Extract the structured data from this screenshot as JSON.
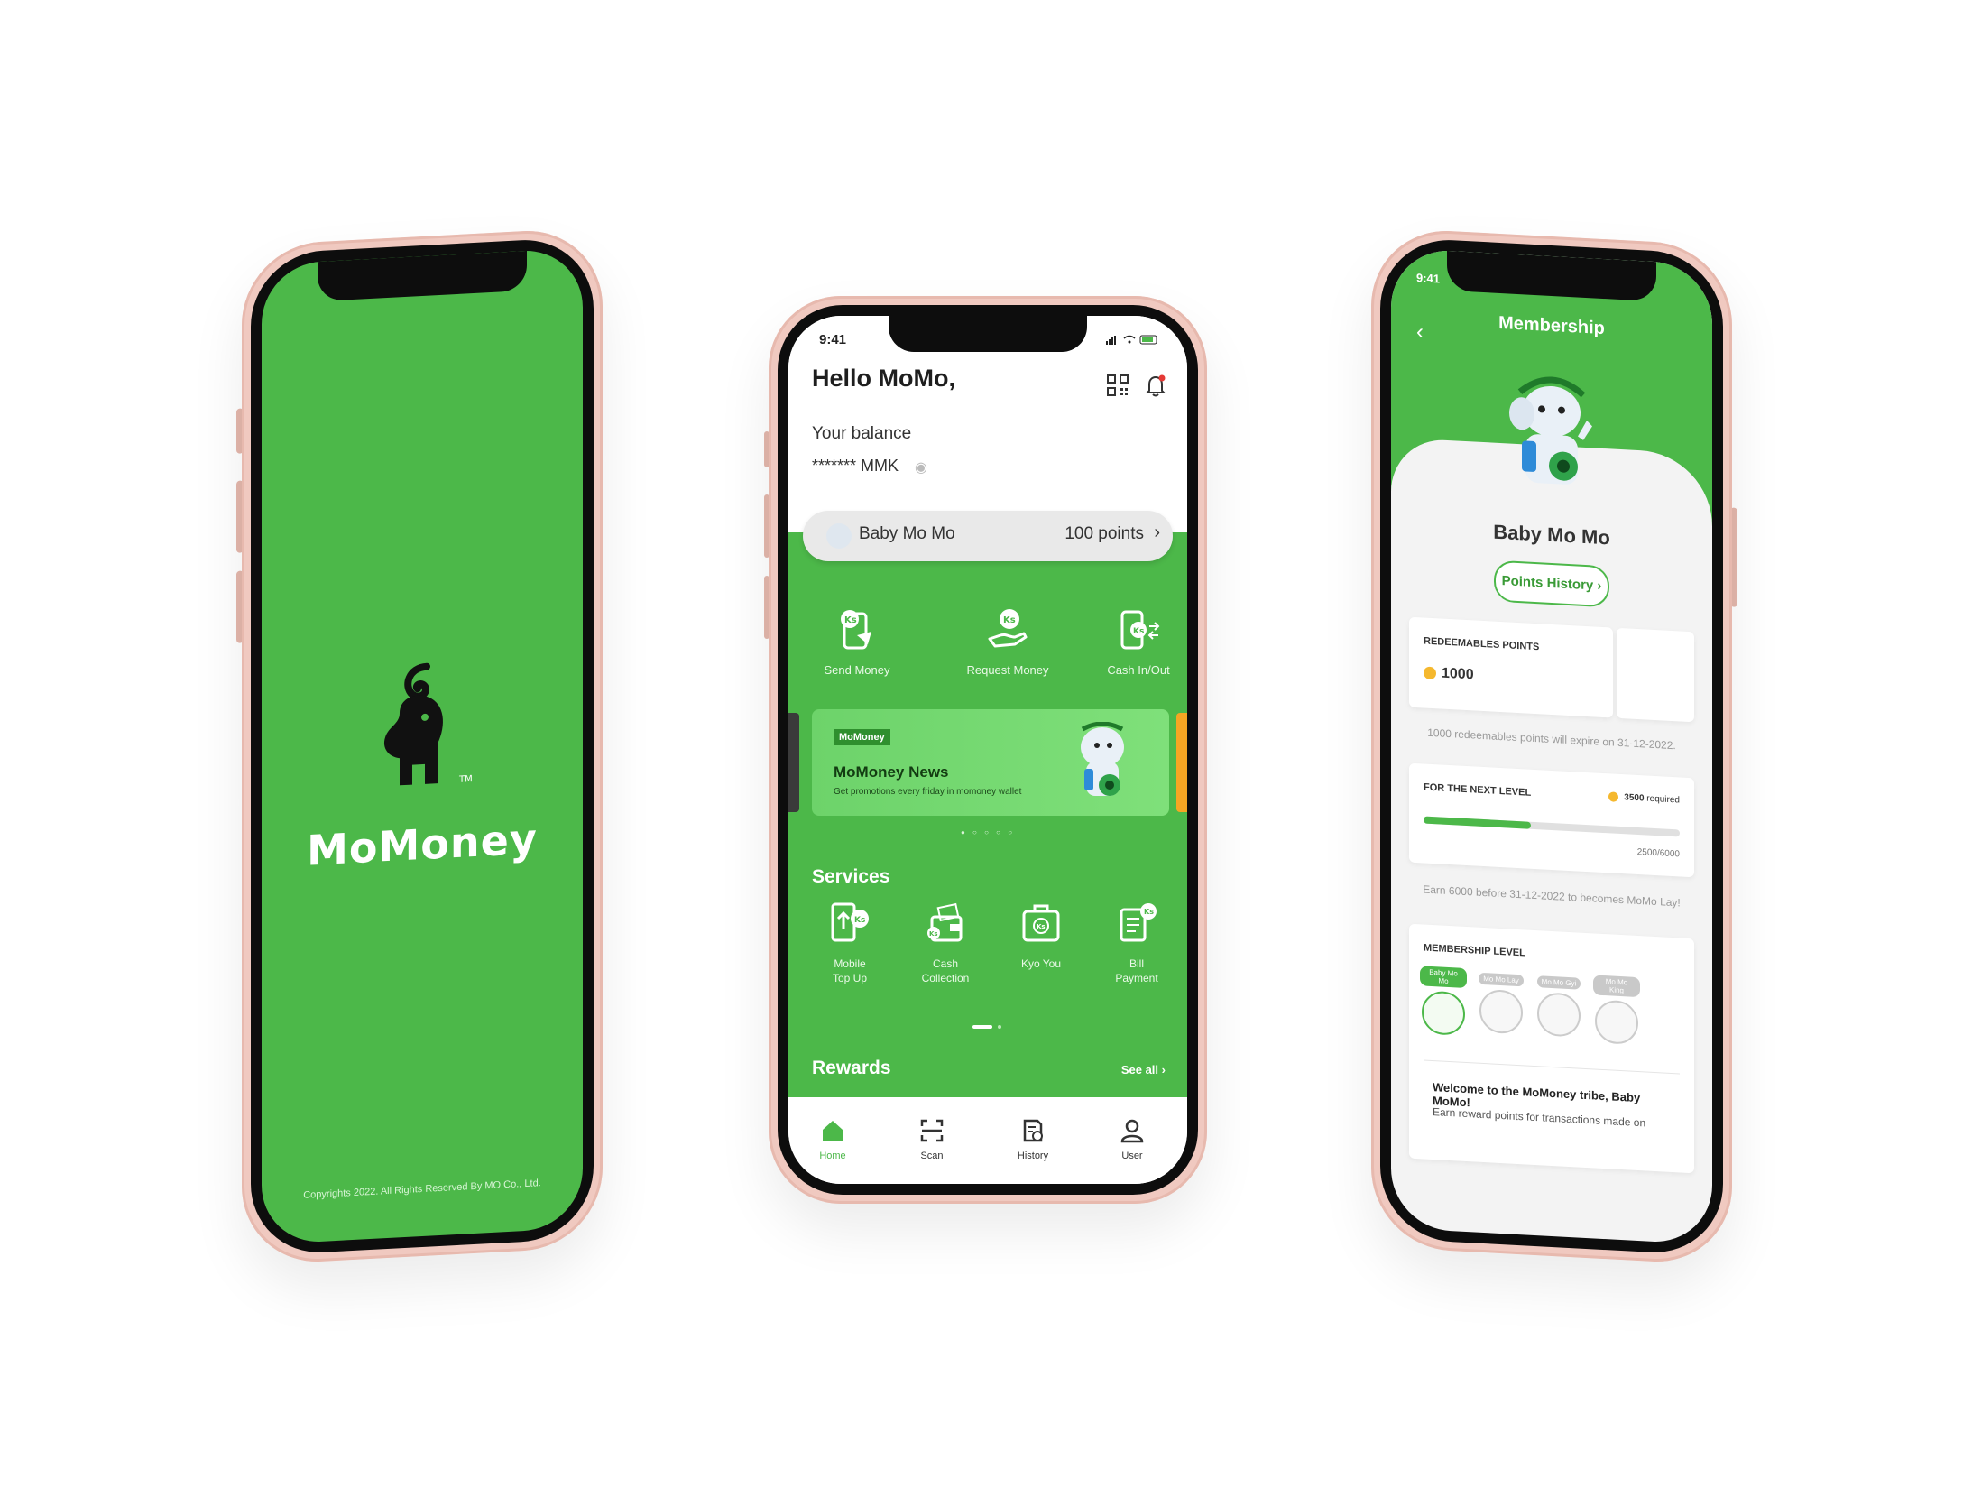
{
  "splash": {
    "brand": "MoMoney",
    "trademark": "TM",
    "copyright": "Copyrights 2022. All Rights Reserved By MO Co., Ltd."
  },
  "home": {
    "status_time": "9:41",
    "greeting": "Hello MoMo,",
    "balance_label": "Your balance",
    "balance_value": "******* MMK",
    "membership_name": "Baby Mo Mo",
    "membership_points": "100 points",
    "actions": [
      {
        "label": "Send Money",
        "icon": "send-money-icon"
      },
      {
        "label": "Request Money",
        "icon": "request-money-icon"
      },
      {
        "label": "Cash In/Out",
        "icon": "cash-in-out-icon"
      }
    ],
    "news": {
      "badge": "MoMoney",
      "title": "MoMoney News",
      "subtitle": "Get promotions every friday in momoney wallet"
    },
    "services_title": "Services",
    "services": [
      {
        "line1": "Mobile",
        "line2": "Top Up",
        "icon": "mobile-top-up-icon"
      },
      {
        "line1": "Cash",
        "line2": "Collection",
        "icon": "cash-collection-icon"
      },
      {
        "line1": "Kyo You",
        "line2": "",
        "icon": "kyo-you-icon"
      },
      {
        "line1": "Bill",
        "line2": "Payment",
        "icon": "bill-payment-icon"
      }
    ],
    "rewards_title": "Rewards",
    "see_all": "See all",
    "tabs": [
      {
        "label": "Home",
        "icon": "home-icon",
        "active": true
      },
      {
        "label": "Scan",
        "icon": "scan-icon",
        "active": false
      },
      {
        "label": "History",
        "icon": "history-icon",
        "active": false
      },
      {
        "label": "User",
        "icon": "user-icon",
        "active": false
      }
    ],
    "colors": {
      "primary": "#4cb849",
      "accent": "#f5a623"
    }
  },
  "membership": {
    "status_time": "9:41",
    "title": "Membership",
    "level_name": "Baby Mo Mo",
    "points_history": "Points History",
    "redeemable_label": "REDEEMABLES POINTS",
    "redeemable_value": "1000",
    "expiry_note": "1000 redeemables points will expire on 31-12-2022.",
    "next_level_label": "FOR THE NEXT LEVEL",
    "required": "3500",
    "required_unit": "required",
    "progress_text": "2500/6000",
    "progress_fraction": 0.42,
    "earn_note": "Earn 6000 before 31-12-2022 to becomes MoMo Lay!",
    "membership_level_label": "MEMBERSHIP LEVEL",
    "levels": [
      {
        "name": "Baby Mo Mo",
        "active": true
      },
      {
        "name": "Mo Mo Lay",
        "active": false
      },
      {
        "name": "Mo Mo Gyi",
        "active": false
      },
      {
        "name": "Mo Mo King",
        "active": false
      }
    ],
    "welcome": "Welcome to the MoMoney tribe, Baby MoMo!",
    "earn_text": "Earn reward points for transactions made on"
  }
}
